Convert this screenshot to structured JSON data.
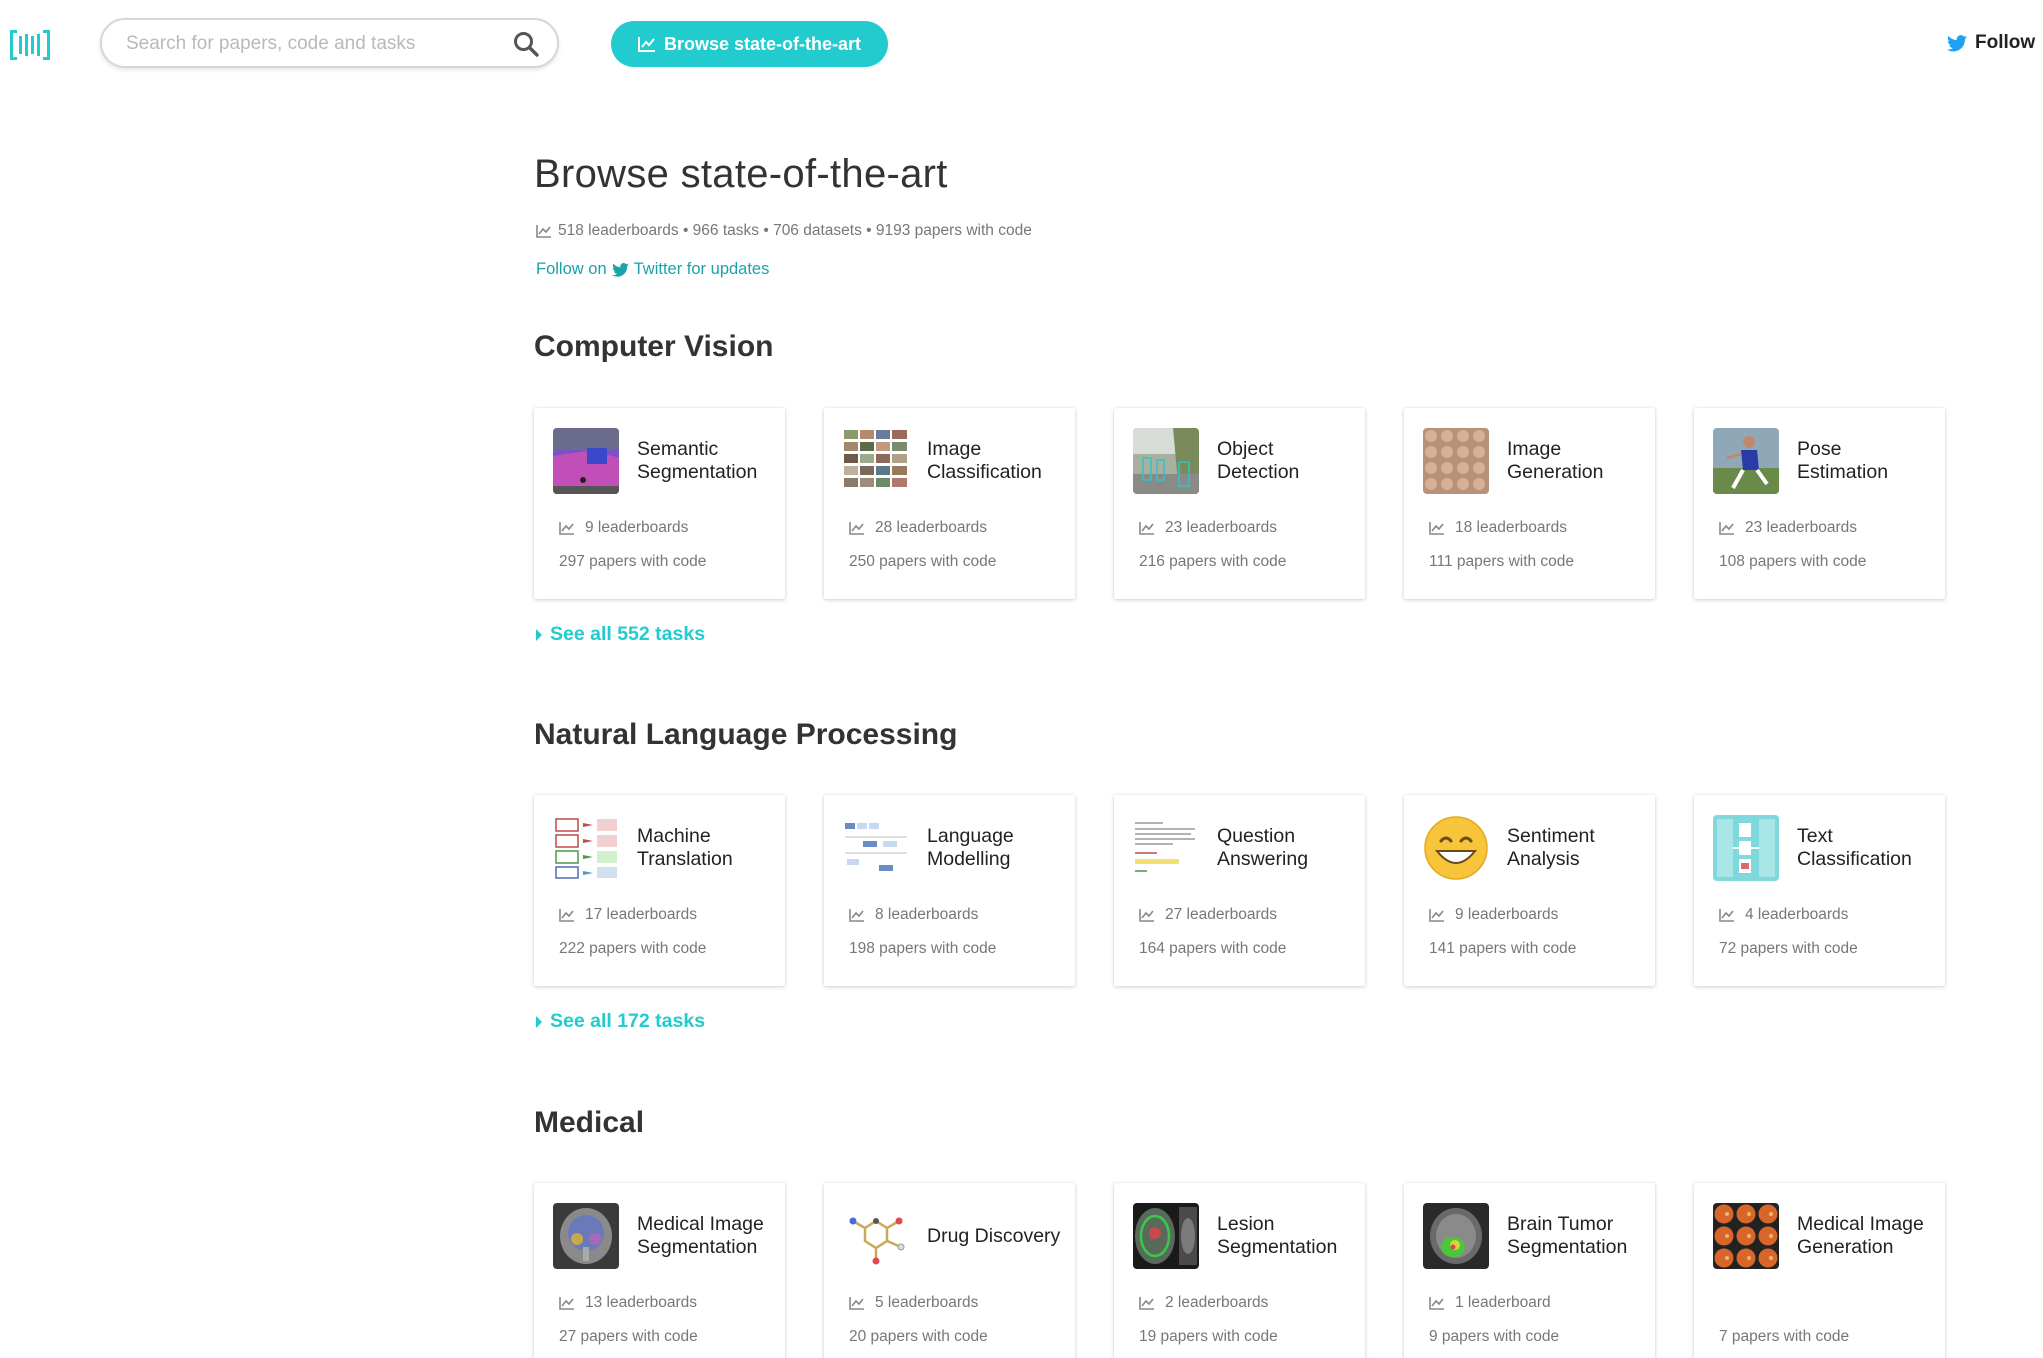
{
  "header": {
    "search_placeholder": "Search for papers, code and tasks",
    "sota_button": "Browse state-of-the-art",
    "follow_label": "Follow",
    "accent_color": "#21cbce",
    "icons": [
      "logo-icon",
      "search-icon",
      "chart-icon",
      "twitter-icon"
    ]
  },
  "intro": {
    "title": "Browse state-of-the-art",
    "stats": "518 leaderboards • 966 tasks • 706 datasets • 9193 papers with code",
    "follow_prefix": "Follow on",
    "follow_suffix": "Twitter for updates"
  },
  "sections": [
    {
      "title": "Computer Vision",
      "see_all": "See all 552 tasks",
      "cards": [
        {
          "title": "Semantic Segmentation",
          "leaderboards": "9 leaderboards",
          "papers": "297 papers with code",
          "thumb": "segmentation-thumb"
        },
        {
          "title": "Image Classification",
          "leaderboards": "28 leaderboards",
          "papers": "250 papers with code",
          "thumb": "image-grid-thumb"
        },
        {
          "title": "Object Detection",
          "leaderboards": "23 leaderboards",
          "papers": "216 papers with code",
          "thumb": "street-thumb"
        },
        {
          "title": "Image Generation",
          "leaderboards": "18 leaderboards",
          "papers": "111 papers with code",
          "thumb": "faces-thumb"
        },
        {
          "title": "Pose Estimation",
          "leaderboards": "23 leaderboards",
          "papers": "108 papers with code",
          "thumb": "athlete-thumb"
        }
      ]
    },
    {
      "title": "Natural Language Processing",
      "see_all": "See all 172 tasks",
      "cards": [
        {
          "title": "Machine Translation",
          "leaderboards": "17 leaderboards",
          "papers": "222 papers with code",
          "thumb": "translation-thumb"
        },
        {
          "title": "Language Modelling",
          "leaderboards": "8 leaderboards",
          "papers": "198 papers with code",
          "thumb": "lm-diagram-thumb"
        },
        {
          "title": "Question Answering",
          "leaderboards": "27 leaderboards",
          "papers": "164 papers with code",
          "thumb": "qa-text-thumb"
        },
        {
          "title": "Sentiment Analysis",
          "leaderboards": "9 leaderboards",
          "papers": "141 papers with code",
          "thumb": "smiley-thumb"
        },
        {
          "title": "Text Classification",
          "leaderboards": "4 leaderboards",
          "papers": "72 papers with code",
          "thumb": "text-class-thumb"
        }
      ]
    },
    {
      "title": "Medical",
      "cards": [
        {
          "title": "Medical Image Segmentation",
          "leaderboards": "13 leaderboards",
          "papers": "27 papers with code",
          "thumb": "mri-thumb"
        },
        {
          "title": "Drug Discovery",
          "leaderboards": "5 leaderboards",
          "papers": "20 papers with code",
          "thumb": "molecule-thumb"
        },
        {
          "title": "Lesion Segmentation",
          "leaderboards": "2 leaderboards",
          "papers": "19 papers with code",
          "thumb": "lesion-thumb"
        },
        {
          "title": "Brain Tumor Segmentation",
          "leaderboards": "1 leaderboard",
          "papers": "9 papers with code",
          "thumb": "brain-thumb"
        },
        {
          "title": "Medical Image Generation",
          "leaderboards": "",
          "papers": "7 papers with code",
          "thumb": "retina-grid-thumb"
        }
      ]
    }
  ]
}
